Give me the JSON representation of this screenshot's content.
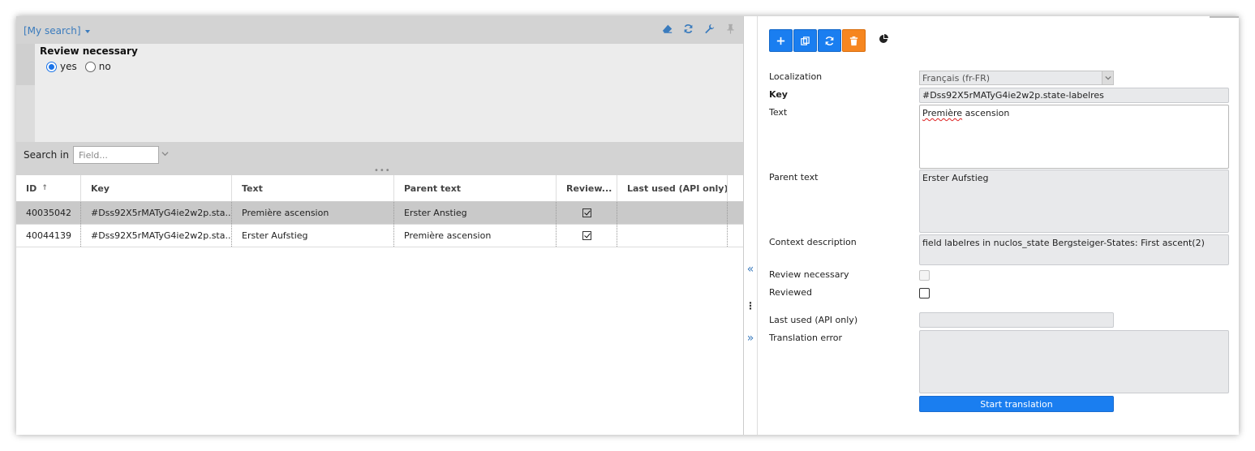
{
  "search": {
    "title": "[My search]",
    "filter_title": "Review necessary",
    "options": [
      {
        "label": "yes",
        "selected": true
      },
      {
        "label": "no",
        "selected": false
      }
    ],
    "search_in_label": "Search in",
    "field_placeholder": "Field...",
    "header_icons": [
      "eraser-icon",
      "refresh-icon",
      "wrench-icon",
      "pin-icon"
    ]
  },
  "grid": {
    "columns": [
      "ID",
      "Key",
      "Text",
      "Parent text",
      "Review...",
      "Last used (API only)"
    ],
    "rows": [
      {
        "id": "40035042",
        "key": "#Dss92X5rMATyG4ie2w2p.sta...",
        "text": "Première ascension",
        "parent": "Erster Anstieg",
        "review": true,
        "last": ""
      },
      {
        "id": "40044139",
        "key": "#Dss92X5rMATyG4ie2w2p.sta...",
        "text": "Erster Aufstieg",
        "parent": "Première ascension",
        "review": true,
        "last": ""
      }
    ]
  },
  "toolbar": {
    "buttons": [
      "add-icon",
      "copy-icon",
      "refresh-icon",
      "delete-icon"
    ],
    "extra_icon": "pie-chart-icon"
  },
  "details": {
    "localization_label": "Localization",
    "localization_value": "Français (fr-FR)",
    "key_label": "Key",
    "key_value": "#Dss92X5rMATyG4ie2w2p.state-labelres",
    "text_label": "Text",
    "text_value": "Première ascension",
    "text_value_rest": "ascension",
    "text_value_first": "Première",
    "parent_label": "Parent text",
    "parent_value": "Erster Aufstieg",
    "context_label": "Context description",
    "context_value": "field labelres in nuclos_state Bergsteiger-States: First ascent(2)",
    "review_label": "Review necessary",
    "reviewed_label": "Reviewed",
    "last_used_label": "Last used (API only)",
    "last_used_value": "",
    "translation_error_label": "Translation error",
    "translation_error_value": "",
    "start_button": "Start translation"
  },
  "colors": {
    "accent": "#1a7ef0",
    "danger": "#f6861f",
    "link": "#3a7bbd"
  }
}
